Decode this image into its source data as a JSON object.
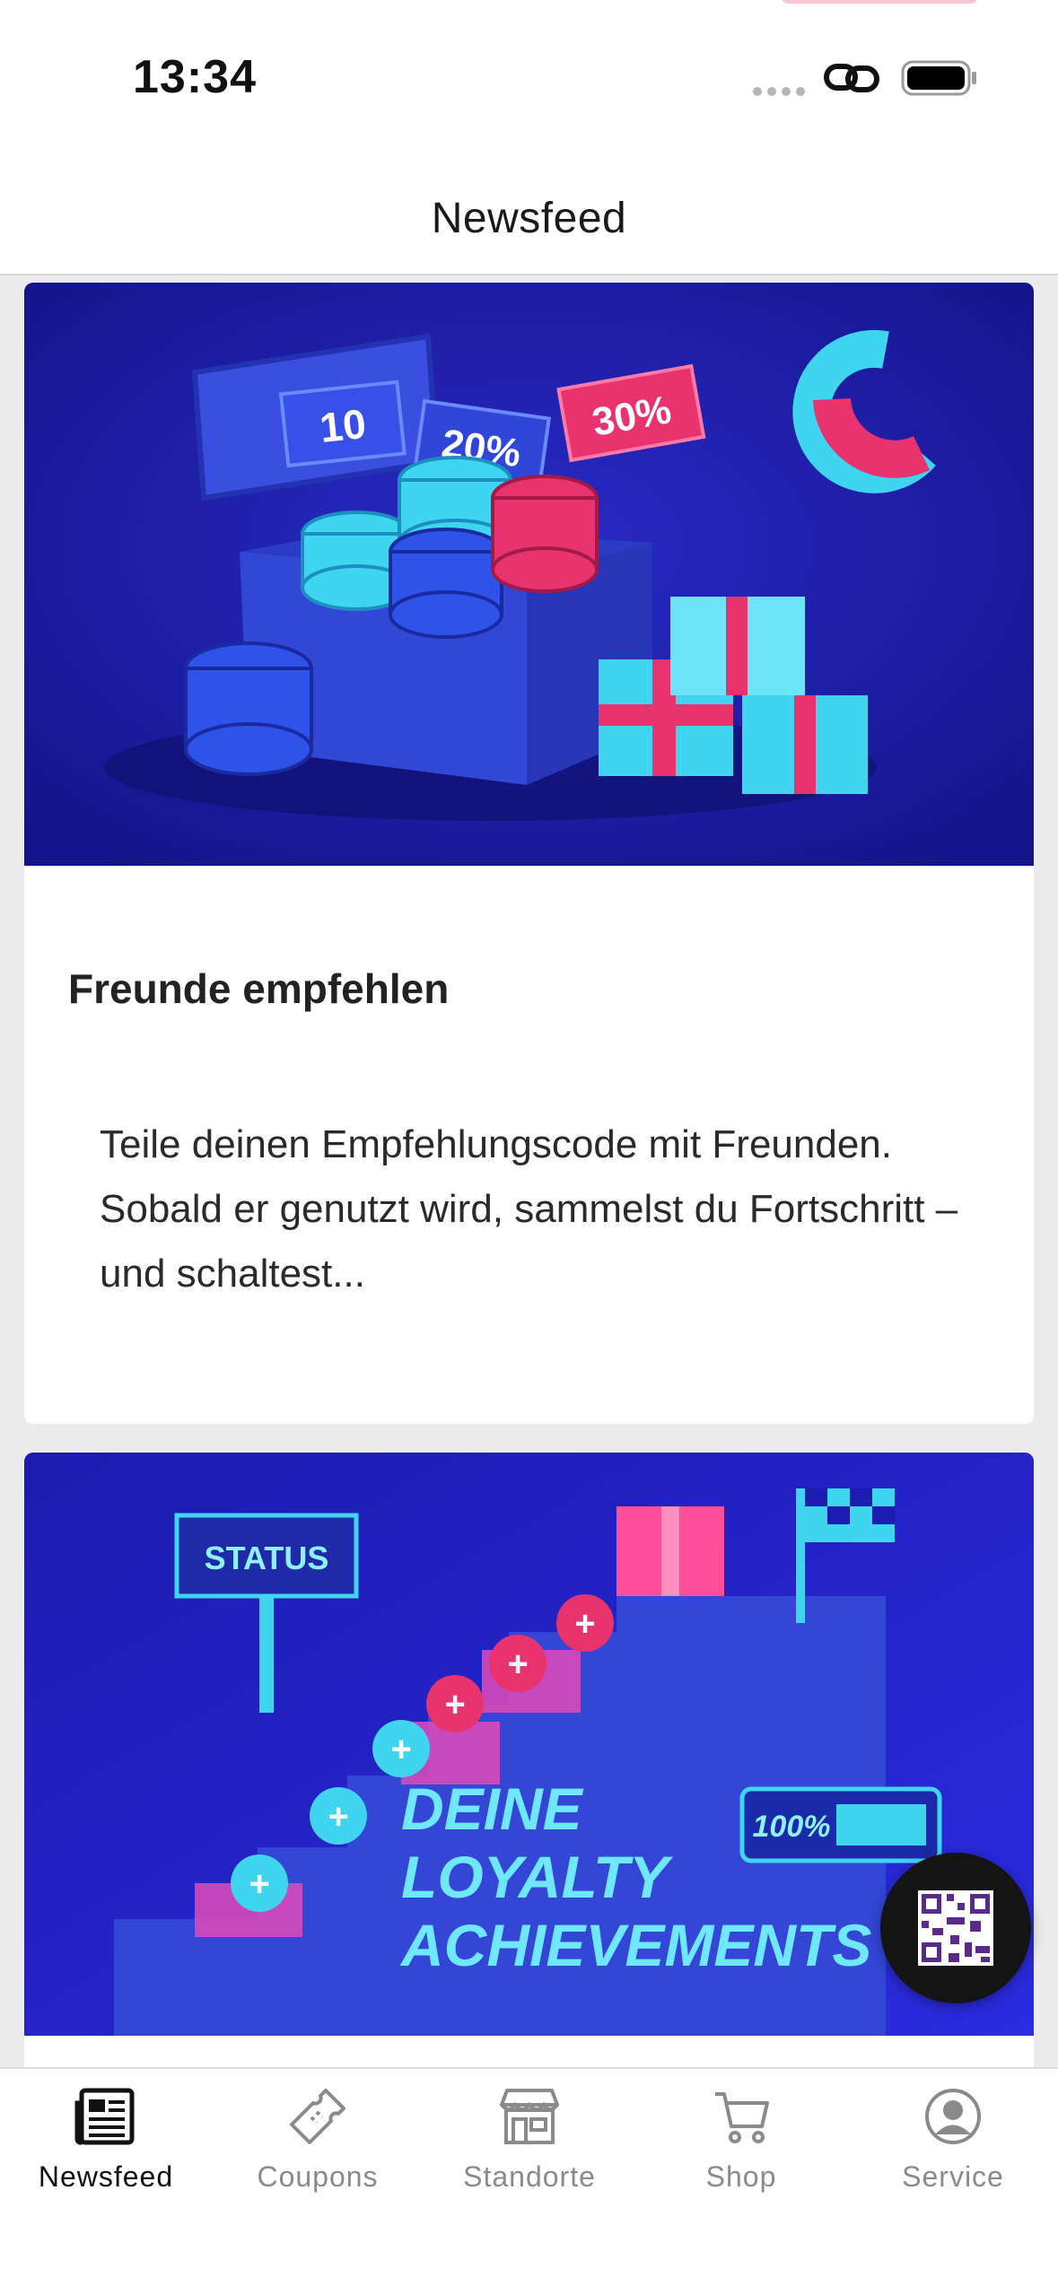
{
  "status": {
    "time": "13:34"
  },
  "nav": {
    "title": "Newsfeed"
  },
  "feed": {
    "items": [
      {
        "title": "Freunde empfehlen",
        "text": "Teile deinen Empfehlungscode mit Freunden. Sobald er genutzt wird, sammelst du Fortschritt – und schaltest...",
        "image_labels": [
          "10",
          "20%",
          "30%"
        ]
      },
      {
        "image_labels": [
          "STATUS",
          "DEINE",
          "LOYALTY",
          "ACHIEVEMENTS",
          "100%"
        ]
      }
    ]
  },
  "fab": {
    "icon": "qr-code-icon"
  },
  "tabs": [
    {
      "label": "Newsfeed",
      "icon": "newspaper-icon",
      "active": true
    },
    {
      "label": "Coupons",
      "icon": "ticket-icon",
      "active": false
    },
    {
      "label": "Standorte",
      "icon": "store-icon",
      "active": false
    },
    {
      "label": "Shop",
      "icon": "cart-icon",
      "active": false
    },
    {
      "label": "Service",
      "icon": "user-circle-icon",
      "active": false
    }
  ],
  "colors": {
    "accent_dark": "#111111",
    "inactive": "#8a8a8a",
    "banner_blue": "#1a1a9e",
    "banner_pink": "#e8336f",
    "banner_cyan": "#3fd4f0"
  }
}
